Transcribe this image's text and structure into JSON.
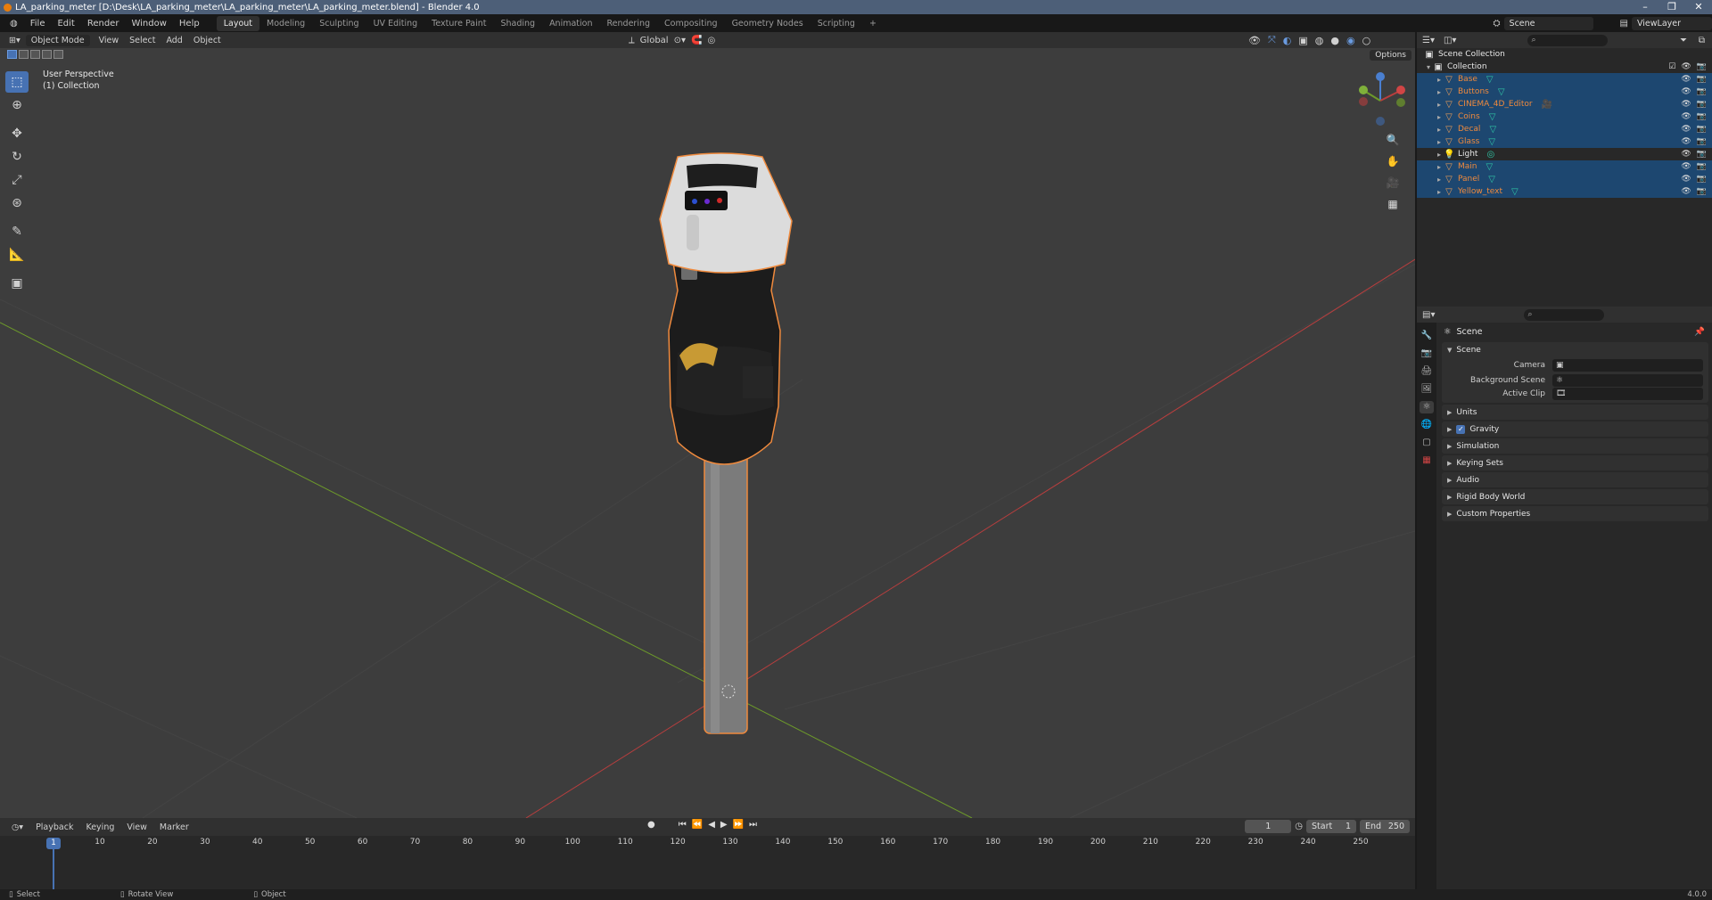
{
  "titlebar": {
    "title": "LA_parking_meter [D:\\Desk\\LA_parking_meter\\LA_parking_meter\\LA_parking_meter.blend] - Blender 4.0"
  },
  "menu": [
    "File",
    "Edit",
    "Render",
    "Window",
    "Help"
  ],
  "workspaces": [
    "Layout",
    "Modeling",
    "Sculpting",
    "UV Editing",
    "Texture Paint",
    "Shading",
    "Animation",
    "Rendering",
    "Compositing",
    "Geometry Nodes",
    "Scripting",
    "+"
  ],
  "topright": {
    "scene": "Scene",
    "viewlayer": "ViewLayer"
  },
  "viewport": {
    "mode": "Object Mode",
    "menus": [
      "View",
      "Select",
      "Add",
      "Object"
    ],
    "orientation": "Global",
    "options": "Options",
    "perspective_label": "User Perspective",
    "collection_label": "(1) Collection"
  },
  "timeline": {
    "menus": [
      "Playback",
      "Keying",
      "View",
      "Marker"
    ],
    "current_frame": "1",
    "start_label": "Start",
    "start": "1",
    "end_label": "End",
    "end": "250",
    "ruler": [
      "10",
      "20",
      "30",
      "40",
      "50",
      "60",
      "70",
      "80",
      "90",
      "100",
      "110",
      "120",
      "130",
      "140",
      "150",
      "160",
      "170",
      "180",
      "190",
      "200",
      "210",
      "220",
      "230",
      "240",
      "250"
    ]
  },
  "statusbar": {
    "select": "Select",
    "rotate": "Rotate View",
    "object": "Object",
    "version": "4.0.0"
  },
  "outliner": {
    "scene_collection": "Scene Collection",
    "collection": "Collection",
    "items": [
      {
        "name": "Base",
        "type": "mesh",
        "selected": true
      },
      {
        "name": "Buttons",
        "type": "mesh",
        "selected": true
      },
      {
        "name": "CINEMA_4D_Editor",
        "type": "camera",
        "selected": true
      },
      {
        "name": "Coins",
        "type": "mesh",
        "selected": true
      },
      {
        "name": "Decal",
        "type": "mesh",
        "selected": true
      },
      {
        "name": "Glass",
        "type": "mesh",
        "selected": true
      },
      {
        "name": "Light",
        "type": "light",
        "selected": false
      },
      {
        "name": "Main",
        "type": "mesh",
        "selected": true
      },
      {
        "name": "Panel",
        "type": "mesh",
        "selected": true
      },
      {
        "name": "Yellow_text",
        "type": "mesh",
        "selected": true
      }
    ]
  },
  "properties": {
    "breadcrumb": "Scene",
    "scene_panel": "Scene",
    "camera_label": "Camera",
    "bg_scene_label": "Background Scene",
    "active_clip_label": "Active Clip",
    "panels": [
      "Units",
      "Gravity",
      "Simulation",
      "Keying Sets",
      "Audio",
      "Rigid Body World",
      "Custom Properties"
    ]
  },
  "colors": {
    "accent": "#4772b3",
    "selection": "#f08a3d",
    "x_axis": "#b83e3e",
    "y_axis": "#6d9a2a"
  }
}
